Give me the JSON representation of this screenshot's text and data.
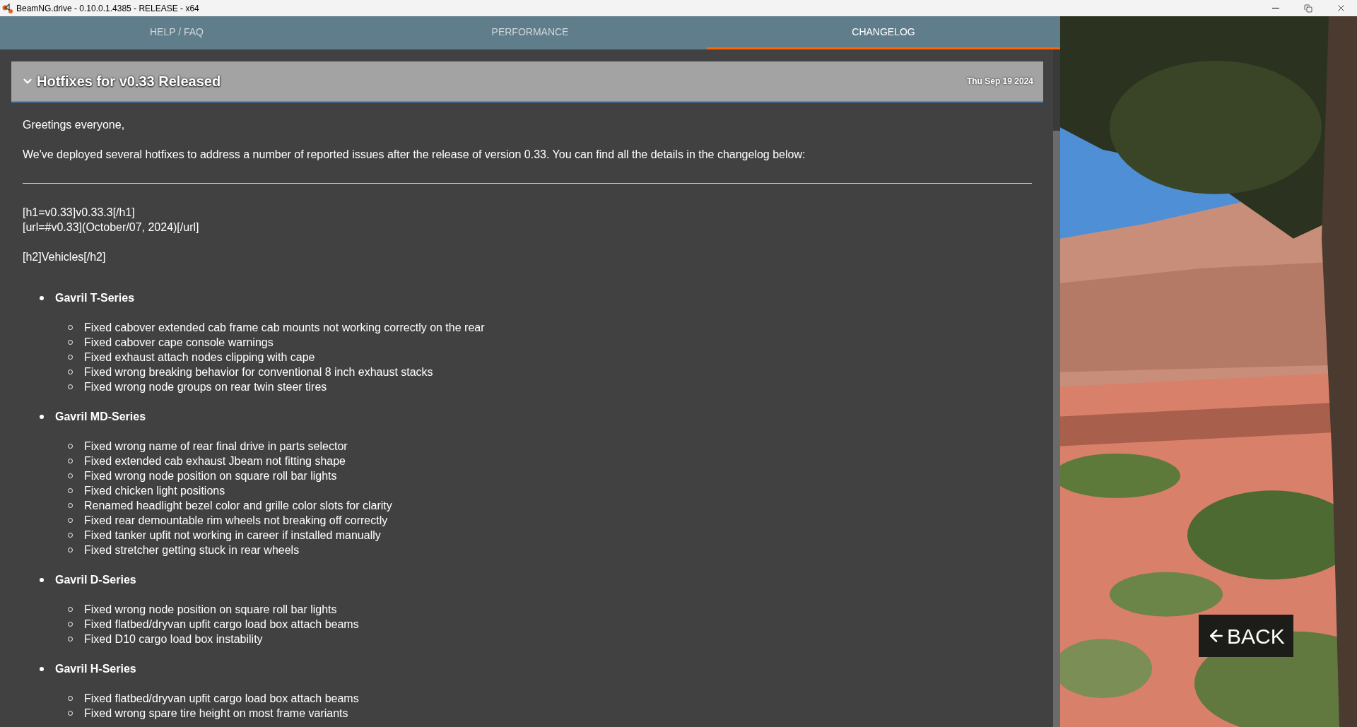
{
  "window": {
    "title": "BeamNG.drive - 0.10.0.1.4385 - RELEASE - x64"
  },
  "tabs": [
    {
      "label": "HELP / FAQ",
      "selected": false
    },
    {
      "label": "PERFORMANCE",
      "selected": false
    },
    {
      "label": "CHANGELOG",
      "selected": true
    }
  ],
  "article": {
    "title": "Hotfixes for v0.33 Released",
    "date": "Thu Sep 19 2024",
    "expanded": true,
    "intro": [
      "Greetings everyone,",
      "We've deployed several hotfixes to address a number of reported issues after the release of version 0.33. You can find all the details in the changelog below:"
    ],
    "markup_lines": [
      [
        "[h1=v0.33]v0.33.3[/h1]",
        "[url=#v0.33](October/07, 2024)[/url]"
      ],
      [
        "[h2]Vehicles[/h2]"
      ]
    ],
    "sections": [
      {
        "title": "Gavril T-Series",
        "items": [
          "Fixed cabover extended cab frame cab mounts not working correctly on the rear",
          "Fixed cabover cape console warnings",
          "Fixed exhaust attach nodes clipping with cape",
          "Fixed wrong breaking behavior for conventional 8 inch exhaust stacks",
          "Fixed wrong node groups on rear twin steer tires"
        ]
      },
      {
        "title": "Gavril MD-Series",
        "items": [
          "Fixed wrong name of rear final drive in parts selector",
          "Fixed extended cab exhaust Jbeam not fitting shape",
          "Fixed wrong node position on square roll bar lights",
          "Fixed chicken light positions",
          "Renamed headlight bezel color and grille color slots for clarity",
          "Fixed rear demountable rim wheels not breaking off correctly",
          "Fixed tanker upfit not working in career if installed manually",
          "Fixed stretcher getting stuck in rear wheels"
        ]
      },
      {
        "title": "Gavril D-Series",
        "items": [
          "Fixed wrong node position on square roll bar lights",
          "Fixed flatbed/dryvan upfit cargo load box attach beams",
          "Fixed D10 cargo load box instability"
        ]
      },
      {
        "title": "Gavril H-Series",
        "items": [
          "Fixed flatbed/dryvan upfit cargo load box attach beams",
          "Fixed wrong spare tire height on most frame variants"
        ]
      }
    ]
  },
  "back_button": {
    "label": "BACK"
  }
}
